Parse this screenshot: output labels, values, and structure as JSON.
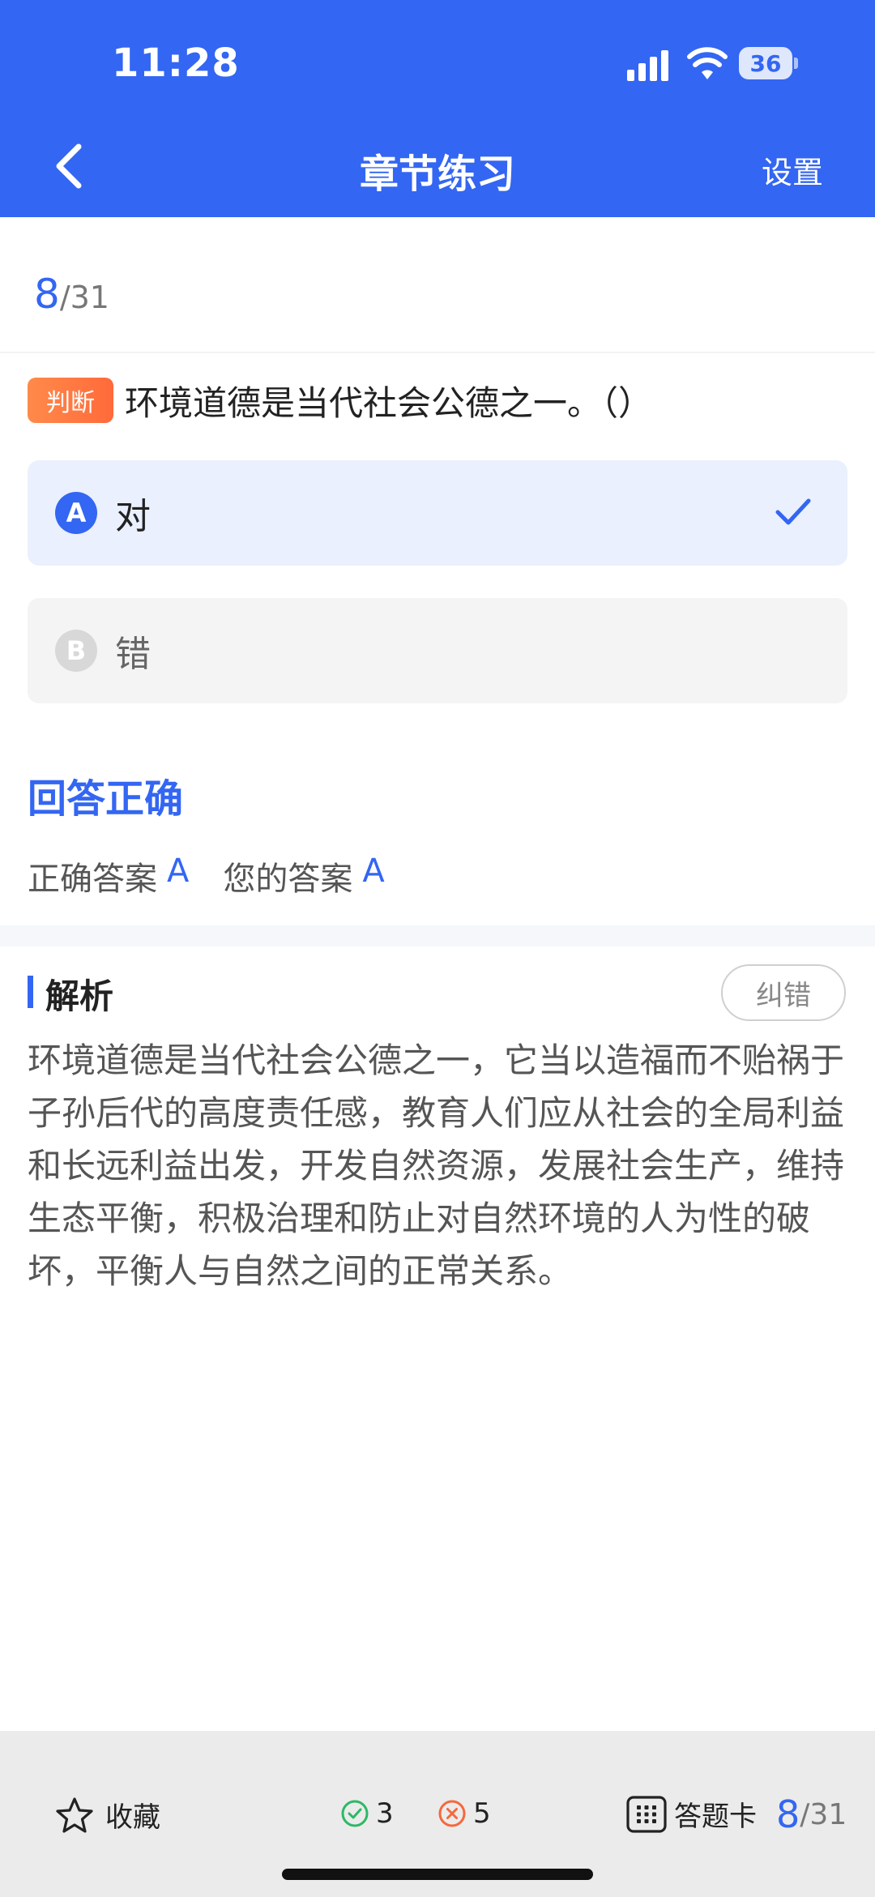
{
  "status_bar": {
    "time": "11:28",
    "battery": "36"
  },
  "header": {
    "title": "章节练习",
    "settings_label": "设置"
  },
  "progress": {
    "current": "8",
    "total": "/31"
  },
  "question": {
    "type_tag": "判断",
    "text": "环境道德是当代社会公德之一。（）",
    "options": [
      {
        "letter": "A",
        "text": "对",
        "selected": true
      },
      {
        "letter": "B",
        "text": "错",
        "selected": false
      }
    ]
  },
  "result": {
    "title": "回答正确",
    "correct_label": "正确答案",
    "correct_value": "A",
    "yours_label": "您的答案",
    "yours_value": "A"
  },
  "analysis": {
    "title": "解析",
    "report_label": "纠错",
    "text": "环境道德是当代社会公德之一，它当以造福而不贻祸于子孙后代的高度责任感，教育人们应从社会的全局利益和长远利益出发，开发自然资源，发展社会生产，维持生态平衡，积极治理和防止对自然环境的人为性的破坏，平衡人与自然之间的正常关系。"
  },
  "toolbar": {
    "favorite_label": "收藏",
    "right_count": "3",
    "wrong_count": "5",
    "answer_card_label": "答题卡",
    "progress_current": "8",
    "progress_total": "/31"
  },
  "colors": {
    "primary": "#3366f2",
    "tag": "#ff6a3a",
    "right": "#2eb866",
    "wrong": "#f5683d"
  }
}
